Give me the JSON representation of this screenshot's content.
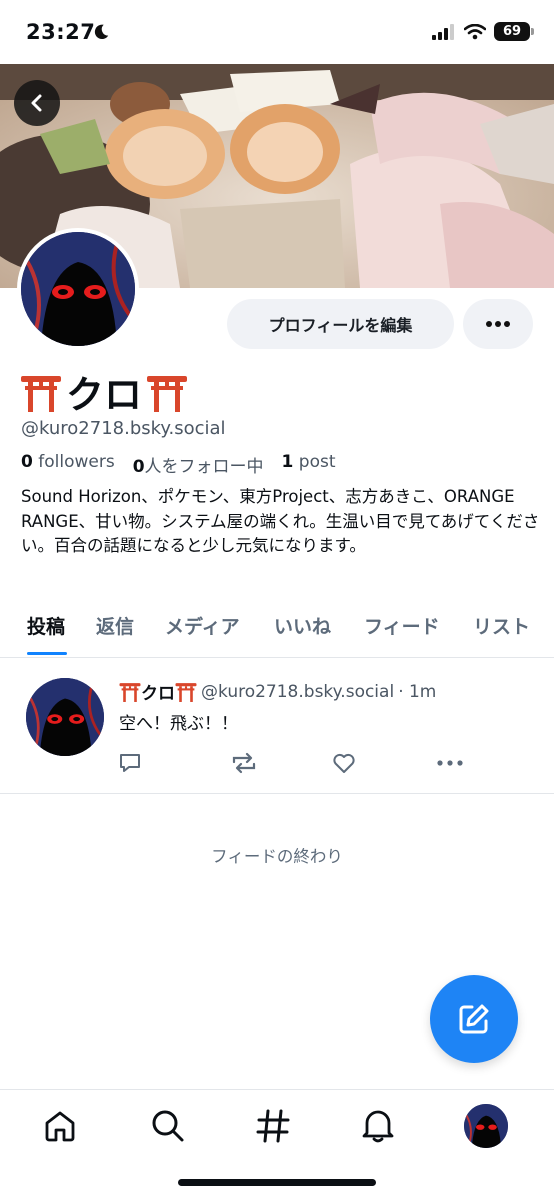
{
  "status_bar": {
    "time": "23:27",
    "battery": "69"
  },
  "profile": {
    "display_name": "クロ",
    "handle": "@kuro2718.bsky.social",
    "followers_count": "0",
    "followers_label": "followers",
    "following_count": "0",
    "following_label": "人をフォロー中",
    "posts_count": "1",
    "posts_label": "post",
    "bio": "Sound Horizon、ポケモン、東方Project、志方あきこ、ORANGE RANGE、甘い物。システム屋の端くれ。生温い目で見てあげてください。百合の話題になると少し元気になります。",
    "edit_button": "プロフィールを編集"
  },
  "tabs": [
    "投稿",
    "返信",
    "メディア",
    "いいね",
    "フィード",
    "リスト"
  ],
  "active_tab": "投稿",
  "posts": [
    {
      "author": "クロ",
      "handle": "@kuro2718.bsky.social",
      "time": "· 1m",
      "text": "空へ！飛ぶ！！"
    }
  ],
  "feed_end": "フィードの終わり",
  "colors": {
    "accent": "#1083fe",
    "fab": "#1e84f5",
    "muted": "#5d6b7b",
    "torii": "#d9462b"
  },
  "icons": [
    "back-arrow-icon",
    "more-icon",
    "reply-icon",
    "repost-icon",
    "like-icon",
    "compose-icon",
    "home-icon",
    "search-icon",
    "feeds-hash-icon",
    "notifications-bell-icon"
  ]
}
